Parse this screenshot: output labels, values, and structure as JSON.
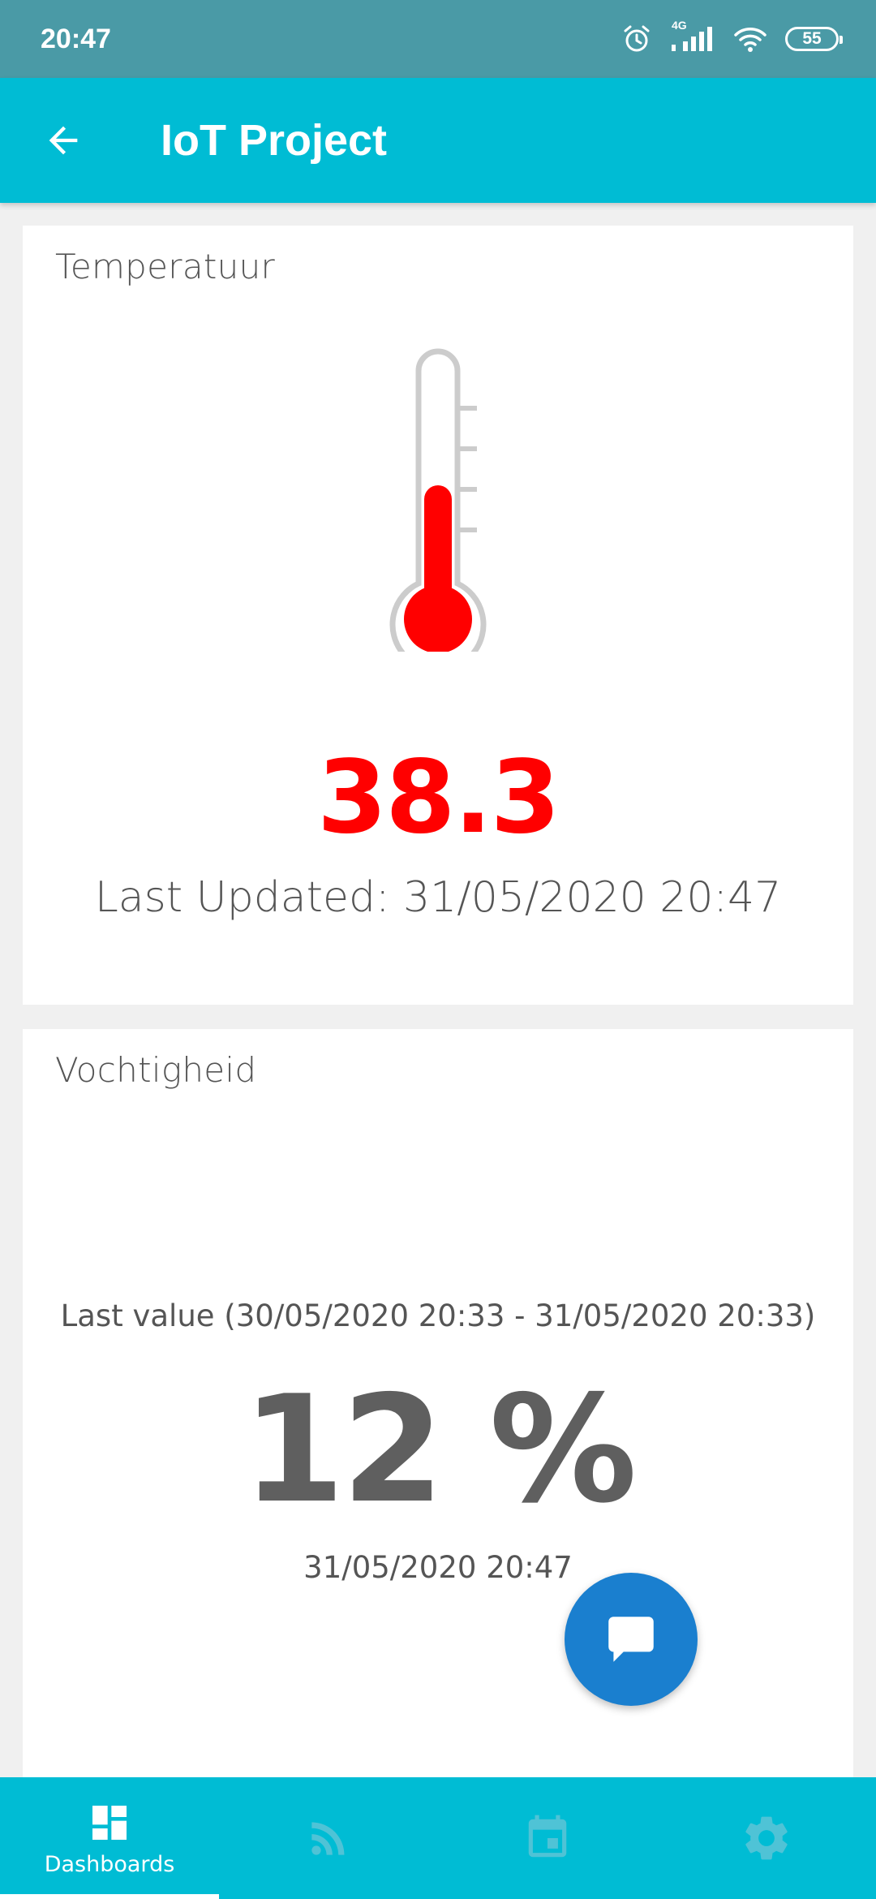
{
  "status_bar": {
    "time": "20:47",
    "network_label": "4G",
    "battery_level": "55",
    "icons": [
      "alarm-icon",
      "signal-icon",
      "wifi-icon",
      "battery-icon"
    ]
  },
  "app_bar": {
    "title": "IoT Project",
    "back_icon": "arrow-back-icon"
  },
  "temperature_card": {
    "title": "Temperatuur",
    "value": "38.3",
    "thermometer_fill_fraction": 0.55,
    "last_updated": "Last Updated: 31/05/2020 20:47",
    "value_color": "#ff0000"
  },
  "humidity_card": {
    "title": "Vochtigheid",
    "range_label": "Last value (30/05/2020 20:33 - 31/05/2020 20:33)",
    "value": "12 %",
    "updated": "31/05/2020 20:47"
  },
  "fab": {
    "icon": "chat-icon"
  },
  "bottom_nav": {
    "items": [
      {
        "label": "Dashboards",
        "icon": "dashboard-icon",
        "active": true
      },
      {
        "label": "",
        "icon": "rss-feed-icon",
        "active": false
      },
      {
        "label": "",
        "icon": "calendar-icon",
        "active": false
      },
      {
        "label": "",
        "icon": "settings-icon",
        "active": false
      }
    ]
  },
  "colors": {
    "status_bar": "#4a9aa6",
    "primary": "#00bcd4",
    "fab": "#1a7fcf",
    "background": "#f0f0f0"
  }
}
